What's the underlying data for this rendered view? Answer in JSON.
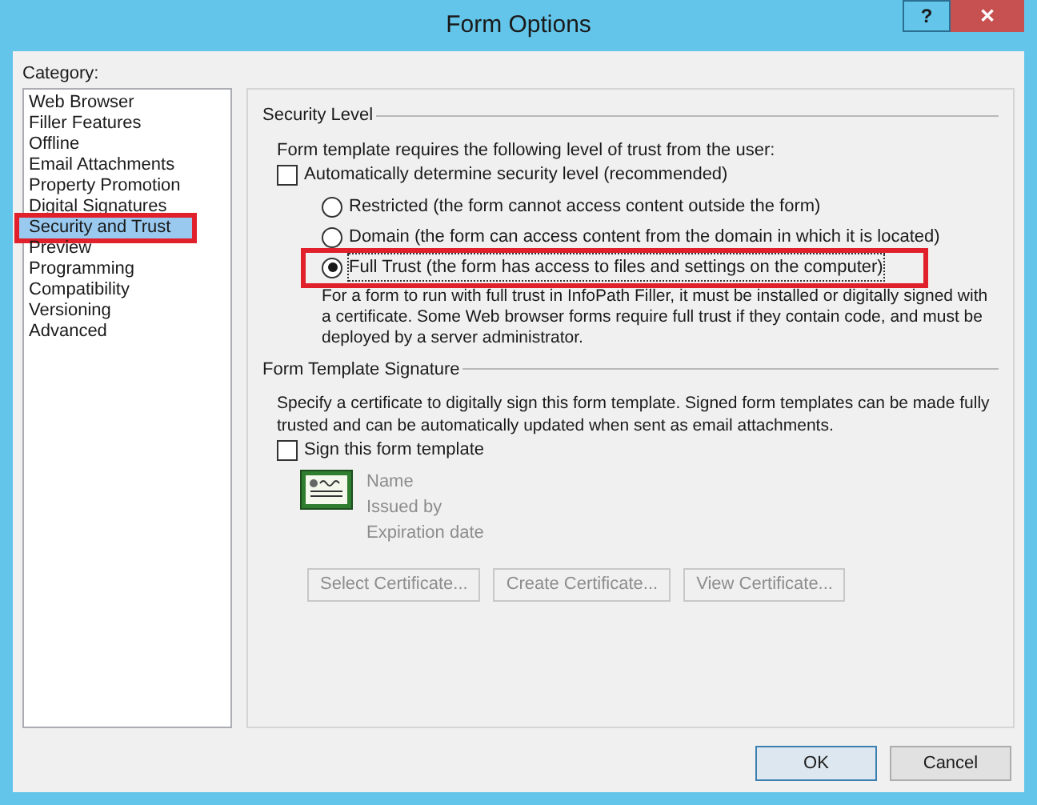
{
  "window": {
    "title": "Form Options",
    "help": "?",
    "close": "✕"
  },
  "category": {
    "label": "Category:",
    "items": [
      {
        "label": "Web Browser",
        "selected": false,
        "highlighted": false
      },
      {
        "label": "Filler Features",
        "selected": false,
        "highlighted": false
      },
      {
        "label": "Offline",
        "selected": false,
        "highlighted": false
      },
      {
        "label": "Email Attachments",
        "selected": false,
        "highlighted": false
      },
      {
        "label": "Property Promotion",
        "selected": false,
        "highlighted": false
      },
      {
        "label": "Digital Signatures",
        "selected": false,
        "highlighted": false
      },
      {
        "label": "Security and Trust",
        "selected": true,
        "highlighted": true
      },
      {
        "label": "Preview",
        "selected": false,
        "highlighted": false
      },
      {
        "label": "Programming",
        "selected": false,
        "highlighted": false
      },
      {
        "label": "Compatibility",
        "selected": false,
        "highlighted": false
      },
      {
        "label": "Versioning",
        "selected": false,
        "highlighted": false
      },
      {
        "label": "Advanced",
        "selected": false,
        "highlighted": false
      }
    ]
  },
  "security_level": {
    "heading": "Security Level",
    "intro": "Form template requires the following level of trust from the user:",
    "auto": {
      "label": "Automatically determine security level (recommended)",
      "checked": false
    },
    "options": [
      {
        "label": "Restricted (the form cannot access content outside the form)",
        "selected": false,
        "highlighted": false
      },
      {
        "label": "Domain (the form can access content from the domain in which it is located)",
        "selected": false,
        "highlighted": false
      },
      {
        "label": "Full Trust (the form has access to files and settings on the computer)",
        "selected": true,
        "highlighted": true
      }
    ],
    "note": "For a form to run with full trust in InfoPath Filler, it must be installed or digitally signed with a certificate. Some Web browser forms require full trust if they contain code, and must be deployed by a server administrator."
  },
  "signature": {
    "heading": "Form Template Signature",
    "description": "Specify a certificate to digitally sign this form template. Signed form templates can be made fully trusted and can be automatically updated when sent as email attachments.",
    "sign": {
      "label": "Sign this form template",
      "checked": false
    },
    "details": [
      "Name",
      "Issued by",
      "Expiration date"
    ],
    "buttons": [
      {
        "label": "Select Certificate...",
        "disabled": true
      },
      {
        "label": "Create Certificate...",
        "disabled": true
      },
      {
        "label": "View Certificate...",
        "disabled": true
      }
    ]
  },
  "buttons": [
    {
      "label": "OK",
      "default": true
    },
    {
      "label": "Cancel",
      "default": false
    }
  ]
}
